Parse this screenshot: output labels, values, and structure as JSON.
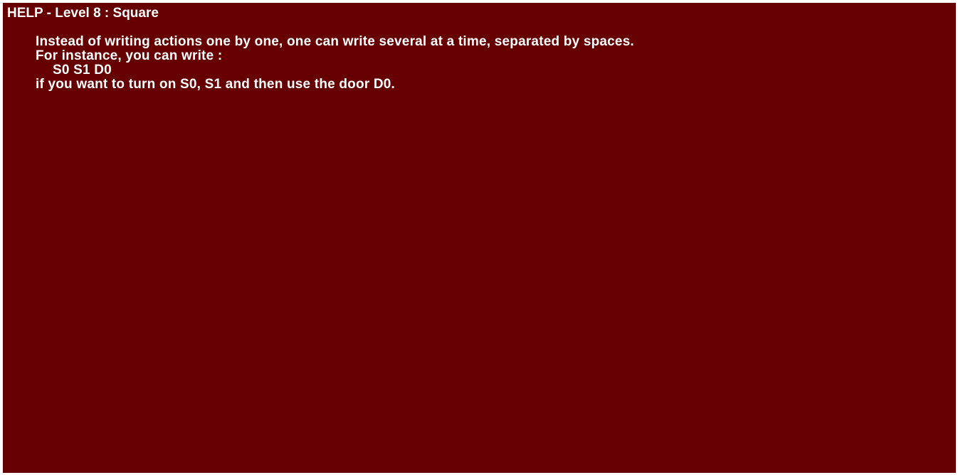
{
  "help": {
    "title": "HELP - Level 8 : Square",
    "lines": [
      "Instead of writing actions one by one, one can write several at a time, separated by spaces.",
      "For instance, you can write :",
      "S0 S1 D0",
      "if you want to turn on S0, S1 and then use the door D0."
    ]
  },
  "colors": {
    "background": "#660000",
    "text": "#ffffff"
  }
}
